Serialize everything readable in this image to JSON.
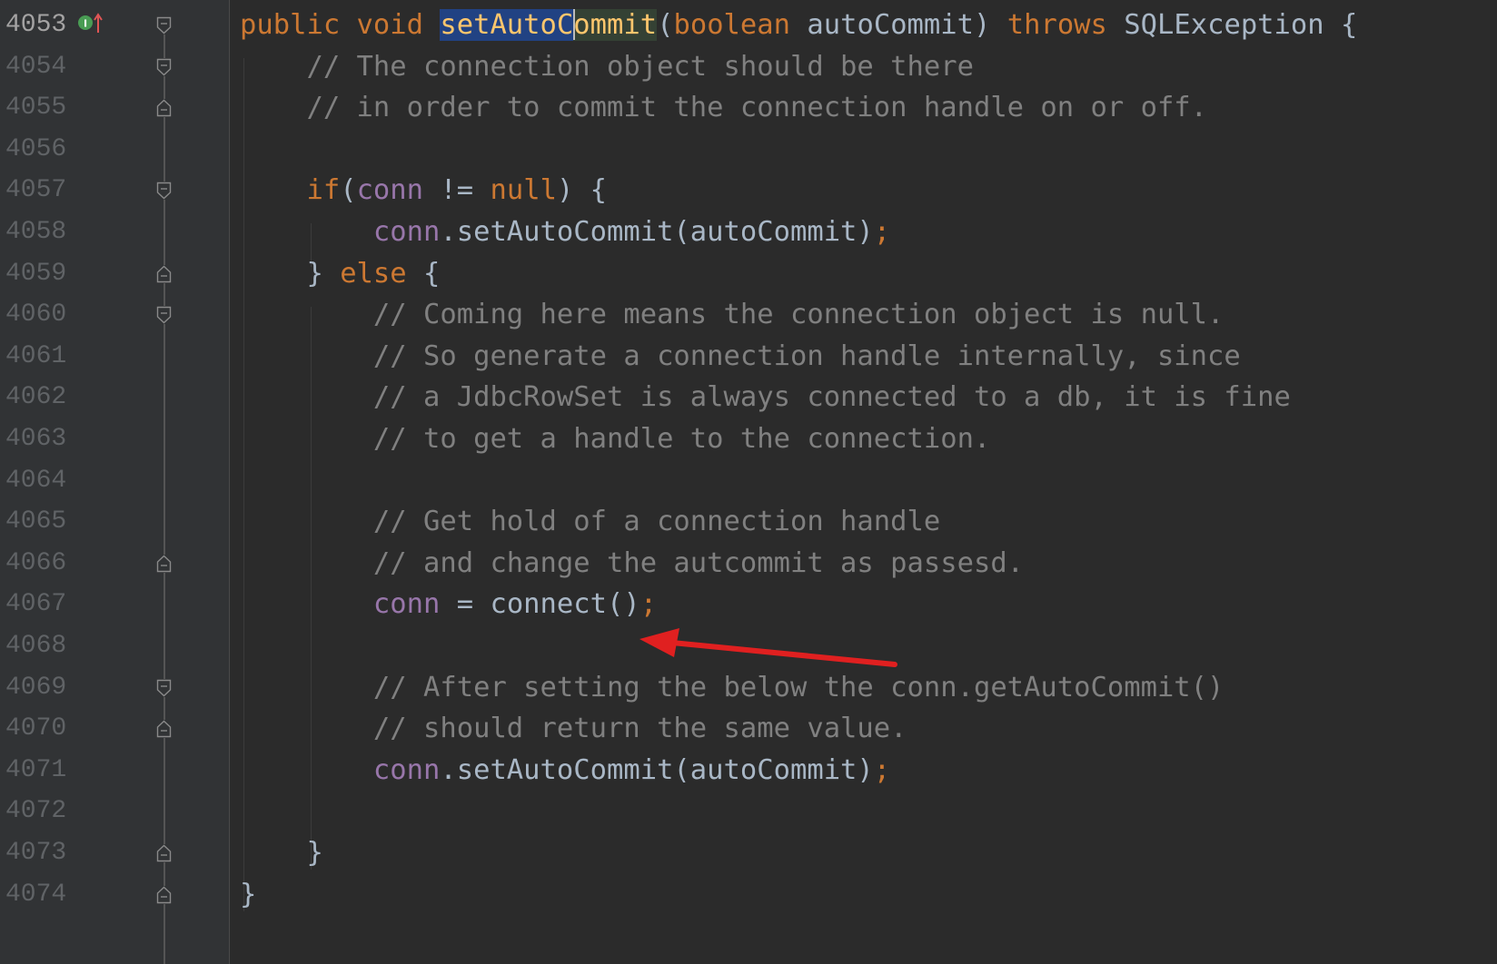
{
  "editor": {
    "lines": [
      {
        "number": "4053",
        "segments": [
          {
            "text": "public void ",
            "role": "kw"
          },
          {
            "text": "setAutoC",
            "role": "hl"
          },
          {
            "text": "",
            "role": "caret"
          },
          {
            "text": "ommit",
            "role": "hl2"
          },
          {
            "text": "(",
            "role": "plain"
          },
          {
            "text": "boolean ",
            "role": "kw"
          },
          {
            "text": "autoCommit) ",
            "role": "plain"
          },
          {
            "text": "throws ",
            "role": "kw"
          },
          {
            "text": "SQLException {",
            "role": "plain"
          }
        ]
      },
      {
        "number": "4054",
        "segments": [
          {
            "text": "    // The connection object should be there",
            "role": "cm"
          }
        ]
      },
      {
        "number": "4055",
        "segments": [
          {
            "text": "    // in order to commit the connection handle on or off.",
            "role": "cm"
          }
        ]
      },
      {
        "number": "4056",
        "segments": []
      },
      {
        "number": "4057",
        "segments": [
          {
            "text": "    ",
            "role": "plain"
          },
          {
            "text": "if",
            "role": "kw"
          },
          {
            "text": "(",
            "role": "plain"
          },
          {
            "text": "conn ",
            "role": "fld"
          },
          {
            "text": "!= ",
            "role": "plain"
          },
          {
            "text": "null",
            "role": "kw"
          },
          {
            "text": ") {",
            "role": "plain"
          }
        ]
      },
      {
        "number": "4058",
        "segments": [
          {
            "text": "        ",
            "role": "plain"
          },
          {
            "text": "conn",
            "role": "fld"
          },
          {
            "text": ".setAutoCommit(autoCommit)",
            "role": "plain"
          },
          {
            "text": ";",
            "role": "kw"
          }
        ]
      },
      {
        "number": "4059",
        "segments": [
          {
            "text": "    } ",
            "role": "plain"
          },
          {
            "text": "else ",
            "role": "kw"
          },
          {
            "text": "{",
            "role": "plain"
          }
        ]
      },
      {
        "number": "4060",
        "segments": [
          {
            "text": "        // Coming here means the connection object is null.",
            "role": "cm"
          }
        ]
      },
      {
        "number": "4061",
        "segments": [
          {
            "text": "        // So generate a connection handle internally, since",
            "role": "cm"
          }
        ]
      },
      {
        "number": "4062",
        "segments": [
          {
            "text": "        // a JdbcRowSet is always connected to a db, it is fine",
            "role": "cm"
          }
        ]
      },
      {
        "number": "4063",
        "segments": [
          {
            "text": "        // to get a handle to the connection.",
            "role": "cm"
          }
        ]
      },
      {
        "number": "4064",
        "segments": []
      },
      {
        "number": "4065",
        "segments": [
          {
            "text": "        // Get hold of a connection handle",
            "role": "cm"
          }
        ]
      },
      {
        "number": "4066",
        "segments": [
          {
            "text": "        // and change the autcommit as passesd.",
            "role": "cm"
          }
        ]
      },
      {
        "number": "4067",
        "segments": [
          {
            "text": "        ",
            "role": "plain"
          },
          {
            "text": "conn ",
            "role": "fld"
          },
          {
            "text": "= connect()",
            "role": "plain"
          },
          {
            "text": ";",
            "role": "kw"
          }
        ]
      },
      {
        "number": "4068",
        "segments": []
      },
      {
        "number": "4069",
        "segments": [
          {
            "text": "        // After setting the below the conn.getAutoCommit()",
            "role": "cm"
          }
        ]
      },
      {
        "number": "4070",
        "segments": [
          {
            "text": "        // should return the same value.",
            "role": "cm"
          }
        ]
      },
      {
        "number": "4071",
        "segments": [
          {
            "text": "        ",
            "role": "plain"
          },
          {
            "text": "conn",
            "role": "fld"
          },
          {
            "text": ".setAutoCommit(autoCommit)",
            "role": "plain"
          },
          {
            "text": ";",
            "role": "kw"
          }
        ]
      },
      {
        "number": "4072",
        "segments": []
      },
      {
        "number": "4073",
        "segments": [
          {
            "text": "    }",
            "role": "plain"
          }
        ]
      },
      {
        "number": "4074",
        "segments": [
          {
            "text": "}",
            "role": "plain"
          }
        ]
      }
    ],
    "fold_markers": {
      "4053": "open",
      "4054": "open",
      "4055": "close",
      "4057": "open",
      "4059": "close",
      "4060": "open",
      "4066": "close",
      "4069": "open",
      "4070": "close",
      "4073": "close",
      "4074": "close"
    },
    "current_line": "4053",
    "gutter_icon": "override-method-icon",
    "annotation": "red-arrow-icon",
    "colors": {
      "background": "#2b2b2b",
      "gutter": "#313335",
      "keyword": "#cc7832",
      "method": "#ffc66d",
      "field": "#9876aa",
      "comment": "#808080",
      "text": "#a9b7c6",
      "selection": "#214283",
      "arrow": "#e02020"
    }
  }
}
